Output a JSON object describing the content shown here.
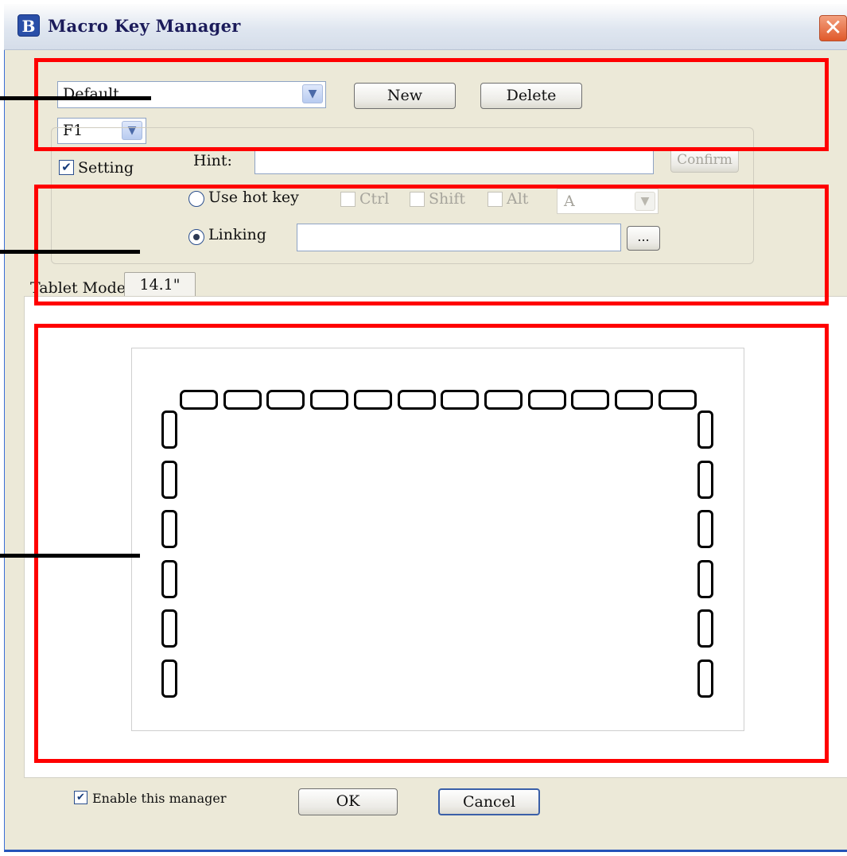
{
  "window": {
    "title": "Macro Key Manager",
    "icon": "app-logo-icon",
    "close": "close-icon"
  },
  "profile": {
    "selected": "Default",
    "new_label": "New",
    "delete_label": "Delete"
  },
  "key_select": {
    "selected": "F1"
  },
  "setting": {
    "label": "Setting",
    "checked": true
  },
  "hint": {
    "label": "Hint:",
    "value": "",
    "confirm_label": "Confirm"
  },
  "hotkey": {
    "label": "Use hot key",
    "ctrl": "Ctrl",
    "shift": "Shift",
    "alt": "Alt",
    "key": "A"
  },
  "linking": {
    "label": "Linking",
    "value": "",
    "browse_label": "..."
  },
  "tablet_mode": {
    "label": "Tablet Mode:",
    "value": "14.1\""
  },
  "keypad": {
    "top_keys": 12,
    "left_keys": 6,
    "right_keys": 6
  },
  "footer": {
    "enable_label": "Enable this manager",
    "enable_checked": true,
    "ok_label": "OK",
    "cancel_label": "Cancel"
  },
  "colors": {
    "highlight": "#ff0000",
    "pointer": "#000000",
    "title_text": "#1b1b5a",
    "window_bg": "#ece9d8"
  }
}
